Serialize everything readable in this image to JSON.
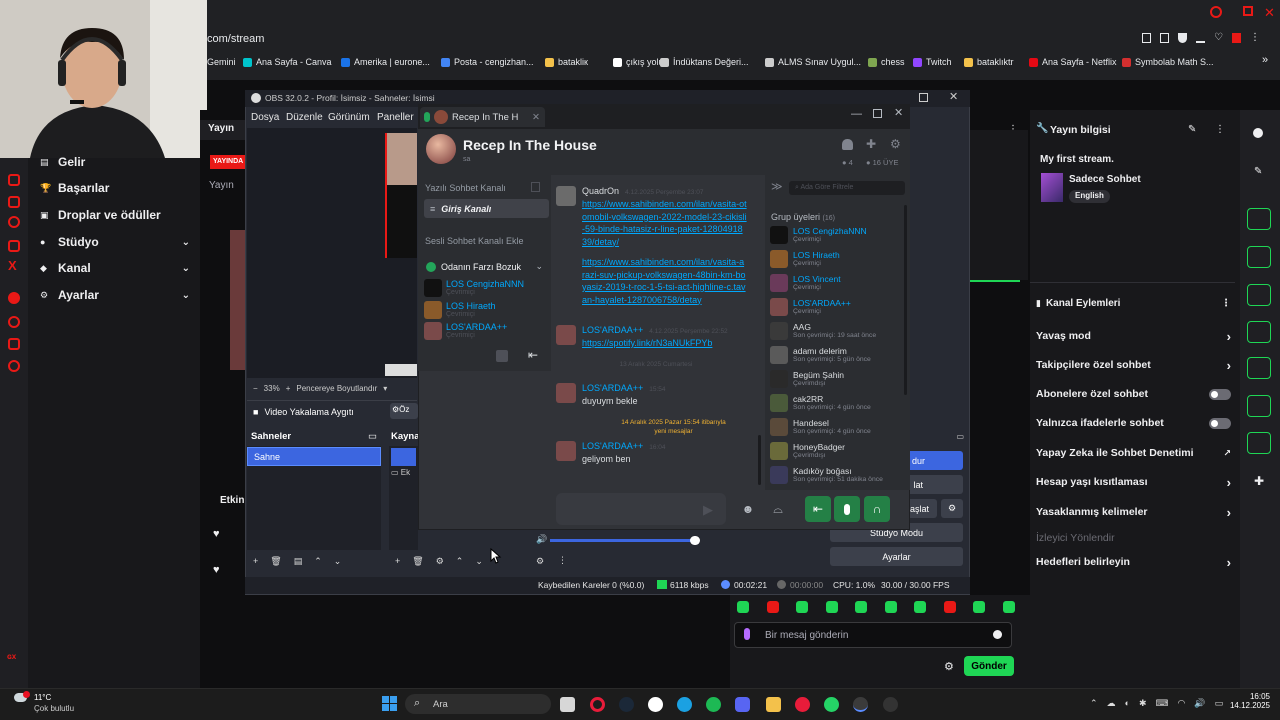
{
  "browser": {
    "url": "com/stream",
    "bookmarks": [
      "Gemini",
      "Ana Sayfa - Canva",
      "Amerika | euronе...",
      "Posta - cengizhan...",
      "batakliк",
      "çıkış yolu",
      "İndüktans Değeri...",
      "ALMS Sınav Uygul...",
      "chess",
      "Twitch",
      "bataklıktr",
      "Ana Sayfa - Netflix",
      "Symbolab Math S..."
    ]
  },
  "twitch_left": {
    "menu": [
      {
        "label": "Gelir",
        "icon": "dollar-icon",
        "expand": false
      },
      {
        "label": "Başarılar",
        "icon": "trophy-icon",
        "expand": false
      },
      {
        "label": "Droplar ve ödüller",
        "icon": "gift-icon",
        "expand": false
      },
      {
        "label": "Stüdyo",
        "icon": "video-icon",
        "expand": true
      },
      {
        "label": "Kanal",
        "icon": "list-icon",
        "expand": true
      },
      {
        "label": "Ayarlar",
        "icon": "gear-icon",
        "expand": true
      }
    ],
    "live_badge": "YAYINDA",
    "yayin_label": "Yayın",
    "etkinlik_label": "Etkin"
  },
  "obs": {
    "title": "OBS 32.0.2 - Profil: İsimsiz - Sahneler: İsimsiz",
    "menu": [
      "Dosya",
      "Düzenle",
      "Görünüm",
      "Paneller"
    ],
    "zoom": "33%",
    "fit_label": "Pencereye Boyutlandır",
    "source_toolbar_label": "Video Yakalama Aygıtı",
    "scenes_title": "Sahneler",
    "sources_title": "Kayna",
    "scene_name": "Sahne",
    "controls": {
      "settings": "Ayarlar",
      "studio": "Stüdyo Modu",
      "start_partial": "aşlat",
      "record_partial": "dur"
    },
    "status": {
      "dropped": "Kaybedilen Kareler 0 (%0.0)",
      "bitrate": "6118 kbps",
      "live_time": "00:02:21",
      "rec_time": "00:00:00",
      "cpu": "CPU: 1.0%",
      "fps": "30.00 / 30.00 FPS"
    }
  },
  "discord": {
    "tab_title": "Recep In The H",
    "server_name": "Recep In The House",
    "server_sub": "sa",
    "member_count": "16 ÜYE",
    "online_count": "4",
    "text_category": "Yazılı Sohbet Kanalı",
    "active_text_channel": "Giriş Kanalı",
    "voice_category": "Sesli Sohbet Kanalı Ekle",
    "voice_channel": "Odanın Farzı Bozuk",
    "voice_users": [
      {
        "name": "LOS CengizhaNNN",
        "status": "Çevrimiçi",
        "color": "#111111"
      },
      {
        "name": "LOS Hiraeth",
        "status": "Çevrimiçi",
        "color": "#8a5a2a"
      },
      {
        "name": "LOS'ARDAA++",
        "status": "Çevrimiçi",
        "color": "#7a4a4a"
      }
    ],
    "messages": [
      {
        "author": "QuadrOn",
        "time": "4.12.2025 Perşembe 23:07",
        "body": "https://www.sahibinden.com/ilan/vasita-otomobil-volkswagen-2022-model-23-cikisli-59-binde-hatasiz-r-line-paket-1280491839/detay/",
        "link": true,
        "avatar": "#6b6b6b"
      },
      {
        "author": "",
        "time": "",
        "body": "https://www.sahibinden.com/ilan/vasita-arazi-suv-pickup-volkswagen-48bin-km-boyasiz-2019-t-roc-1-5-tsi-act-highline-c.tavan-hayalet-1287006758/detay",
        "link": true,
        "avatar": ""
      },
      {
        "author": "LOS'ARDAA++",
        "time": "4.12.2025 Perşembe 22:52",
        "body": "https://spotify.link/rN3aNUkFPYb",
        "link": true,
        "avatar": "#7a4a4a"
      },
      {
        "author": "LOS'ARDAA++",
        "time": "15:54",
        "body": "duyuym bekle",
        "link": false,
        "avatar": "#7a4a4a"
      },
      {
        "author": "LOS'ARDAA++",
        "time": "16:04",
        "body": "geliyom ben",
        "link": false,
        "avatar": "#7a4a4a"
      }
    ],
    "date_sep1": "13 Aralık 2025 Cumartesi",
    "date_sep2": "14 Aralık 2025 Pazar 15:54 itibarıyla yeni mesajlar",
    "member_search_placeholder": "Ada Göre Filtrele",
    "members_heading": "Grup üyeleri",
    "members_count": "(16)",
    "members": [
      {
        "name": "LOS CengizhaNNN",
        "status": "Çevrimiçi",
        "online": true,
        "color": "#111111"
      },
      {
        "name": "LOS Hiraeth",
        "status": "Çevrimiçi",
        "online": true,
        "color": "#8a5a2a"
      },
      {
        "name": "LOS Vincent",
        "status": "Çevrimiçi",
        "online": true,
        "color": "#6a3a5a"
      },
      {
        "name": "LOS'ARDAA++",
        "status": "Çevrimiçi",
        "online": true,
        "color": "#7a4a4a"
      },
      {
        "name": "AAG",
        "status": "Son çevrimiçi: 19 saat önce",
        "online": false,
        "color": "#3a3a3a"
      },
      {
        "name": "adamı delerim",
        "status": "Son çevrimiçi: 5 gün önce",
        "online": false,
        "color": "#5a5a5a"
      },
      {
        "name": "Begüm Şahin",
        "status": "Çevrimdışı",
        "online": false,
        "color": "#2a2a2a"
      },
      {
        "name": "cak2RR",
        "status": "Son çevrimiçi: 4 gün önce",
        "online": false,
        "color": "#4a5a3a"
      },
      {
        "name": "Handesel",
        "status": "Son çevrimiçi: 4 gün önce",
        "online": false,
        "color": "#5a4a3a"
      },
      {
        "name": "HoneyBadger",
        "status": "Çevrimdışı",
        "online": false,
        "color": "#6a6a3a"
      },
      {
        "name": "Kadıköy boğası",
        "status": "Son çevrimiçi: 51 dakika önce",
        "online": false,
        "color": "#3a3a5a"
      }
    ]
  },
  "twitch_right": {
    "stream_info_title": "Yayın bilgisi",
    "stream_title": "My first stream.",
    "category": "Sadece Sohbet",
    "language": "English",
    "channel_actions_title": "Kanal Eylemleri",
    "actions": [
      {
        "label": "Yavaş mod",
        "type": "chevron"
      },
      {
        "label": "Takipçilere özel sohbet",
        "type": "chevron"
      },
      {
        "label": "Abonelere özel sohbet",
        "type": "toggle"
      },
      {
        "label": "Yalnızca ifadelerle sohbet",
        "type": "toggle"
      },
      {
        "label": "Yapay Zeka ile Sohbet Denetimi",
        "type": "external"
      },
      {
        "label": "Hesap yaşı kısıtlaması",
        "type": "chevron"
      },
      {
        "label": "Yasaklanmış kelimeler",
        "type": "chevron"
      },
      {
        "label": "İzleyici Yönlendir",
        "type": "disabled"
      },
      {
        "label": "Hedefleri belirleyin",
        "type": "chevron"
      }
    ],
    "chat_placeholder": "Bir mesaj gönderin",
    "send_label": "Gönder"
  },
  "taskbar": {
    "weather_temp": "11°C",
    "weather_desc": "Çok bulutlu",
    "search_placeholder": "Ara",
    "time": "16:05",
    "date": "14.12.2025"
  },
  "colors": {
    "twitch_green": "#1fd655",
    "discord_blue": "#00a8fc",
    "obs_blue": "#3c66e0",
    "twitch_red": "#e91916"
  }
}
